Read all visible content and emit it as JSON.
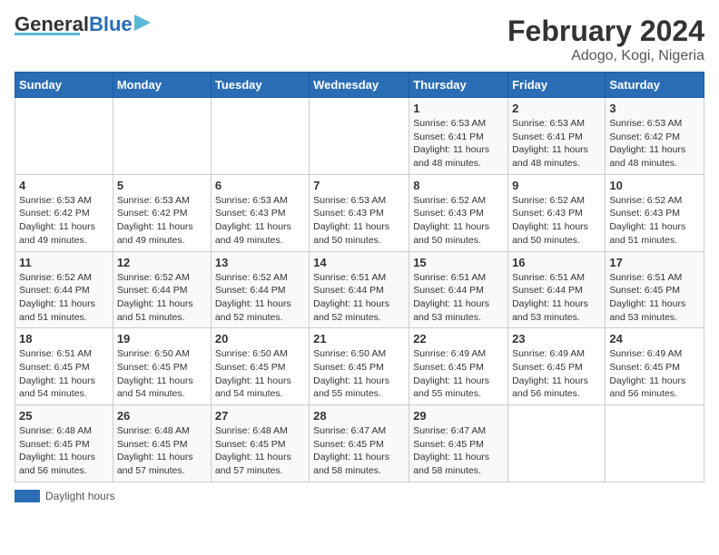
{
  "header": {
    "logo_general": "General",
    "logo_blue": "Blue",
    "title": "February 2024",
    "subtitle": "Adogo, Kogi, Nigeria"
  },
  "weekdays": [
    "Sunday",
    "Monday",
    "Tuesday",
    "Wednesday",
    "Thursday",
    "Friday",
    "Saturday"
  ],
  "legend": {
    "label": "Daylight hours"
  },
  "weeks": [
    [
      {
        "day": "",
        "info": ""
      },
      {
        "day": "",
        "info": ""
      },
      {
        "day": "",
        "info": ""
      },
      {
        "day": "",
        "info": ""
      },
      {
        "day": "1",
        "info": "Sunrise: 6:53 AM\nSunset: 6:41 PM\nDaylight: 11 hours\nand 48 minutes."
      },
      {
        "day": "2",
        "info": "Sunrise: 6:53 AM\nSunset: 6:41 PM\nDaylight: 11 hours\nand 48 minutes."
      },
      {
        "day": "3",
        "info": "Sunrise: 6:53 AM\nSunset: 6:42 PM\nDaylight: 11 hours\nand 48 minutes."
      }
    ],
    [
      {
        "day": "4",
        "info": "Sunrise: 6:53 AM\nSunset: 6:42 PM\nDaylight: 11 hours\nand 49 minutes."
      },
      {
        "day": "5",
        "info": "Sunrise: 6:53 AM\nSunset: 6:42 PM\nDaylight: 11 hours\nand 49 minutes."
      },
      {
        "day": "6",
        "info": "Sunrise: 6:53 AM\nSunset: 6:43 PM\nDaylight: 11 hours\nand 49 minutes."
      },
      {
        "day": "7",
        "info": "Sunrise: 6:53 AM\nSunset: 6:43 PM\nDaylight: 11 hours\nand 50 minutes."
      },
      {
        "day": "8",
        "info": "Sunrise: 6:52 AM\nSunset: 6:43 PM\nDaylight: 11 hours\nand 50 minutes."
      },
      {
        "day": "9",
        "info": "Sunrise: 6:52 AM\nSunset: 6:43 PM\nDaylight: 11 hours\nand 50 minutes."
      },
      {
        "day": "10",
        "info": "Sunrise: 6:52 AM\nSunset: 6:43 PM\nDaylight: 11 hours\nand 51 minutes."
      }
    ],
    [
      {
        "day": "11",
        "info": "Sunrise: 6:52 AM\nSunset: 6:44 PM\nDaylight: 11 hours\nand 51 minutes."
      },
      {
        "day": "12",
        "info": "Sunrise: 6:52 AM\nSunset: 6:44 PM\nDaylight: 11 hours\nand 51 minutes."
      },
      {
        "day": "13",
        "info": "Sunrise: 6:52 AM\nSunset: 6:44 PM\nDaylight: 11 hours\nand 52 minutes."
      },
      {
        "day": "14",
        "info": "Sunrise: 6:51 AM\nSunset: 6:44 PM\nDaylight: 11 hours\nand 52 minutes."
      },
      {
        "day": "15",
        "info": "Sunrise: 6:51 AM\nSunset: 6:44 PM\nDaylight: 11 hours\nand 53 minutes."
      },
      {
        "day": "16",
        "info": "Sunrise: 6:51 AM\nSunset: 6:44 PM\nDaylight: 11 hours\nand 53 minutes."
      },
      {
        "day": "17",
        "info": "Sunrise: 6:51 AM\nSunset: 6:45 PM\nDaylight: 11 hours\nand 53 minutes."
      }
    ],
    [
      {
        "day": "18",
        "info": "Sunrise: 6:51 AM\nSunset: 6:45 PM\nDaylight: 11 hours\nand 54 minutes."
      },
      {
        "day": "19",
        "info": "Sunrise: 6:50 AM\nSunset: 6:45 PM\nDaylight: 11 hours\nand 54 minutes."
      },
      {
        "day": "20",
        "info": "Sunrise: 6:50 AM\nSunset: 6:45 PM\nDaylight: 11 hours\nand 54 minutes."
      },
      {
        "day": "21",
        "info": "Sunrise: 6:50 AM\nSunset: 6:45 PM\nDaylight: 11 hours\nand 55 minutes."
      },
      {
        "day": "22",
        "info": "Sunrise: 6:49 AM\nSunset: 6:45 PM\nDaylight: 11 hours\nand 55 minutes."
      },
      {
        "day": "23",
        "info": "Sunrise: 6:49 AM\nSunset: 6:45 PM\nDaylight: 11 hours\nand 56 minutes."
      },
      {
        "day": "24",
        "info": "Sunrise: 6:49 AM\nSunset: 6:45 PM\nDaylight: 11 hours\nand 56 minutes."
      }
    ],
    [
      {
        "day": "25",
        "info": "Sunrise: 6:48 AM\nSunset: 6:45 PM\nDaylight: 11 hours\nand 56 minutes."
      },
      {
        "day": "26",
        "info": "Sunrise: 6:48 AM\nSunset: 6:45 PM\nDaylight: 11 hours\nand 57 minutes."
      },
      {
        "day": "27",
        "info": "Sunrise: 6:48 AM\nSunset: 6:45 PM\nDaylight: 11 hours\nand 57 minutes."
      },
      {
        "day": "28",
        "info": "Sunrise: 6:47 AM\nSunset: 6:45 PM\nDaylight: 11 hours\nand 58 minutes."
      },
      {
        "day": "29",
        "info": "Sunrise: 6:47 AM\nSunset: 6:45 PM\nDaylight: 11 hours\nand 58 minutes."
      },
      {
        "day": "",
        "info": ""
      },
      {
        "day": "",
        "info": ""
      }
    ]
  ]
}
